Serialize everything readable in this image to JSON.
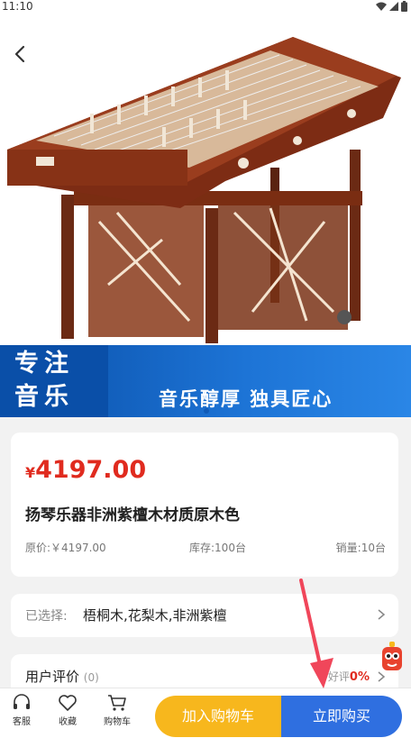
{
  "status_bar": {
    "time": "11:10"
  },
  "banner": {
    "line1": "专注",
    "line2": "音乐",
    "slogan": "音乐醇厚  独具匠心"
  },
  "product": {
    "currency": "¥",
    "price": "4197.00",
    "title": "扬琴乐器非洲紫檀木材质原木色",
    "original_price": "原价:￥4197.00",
    "stock": "库存:100台",
    "sales": "销量:10台"
  },
  "selection": {
    "label": "已选择:",
    "value": "梧桐木,花梨木,非洲紫檀"
  },
  "reviews": {
    "label": "用户评价",
    "count": "(0)",
    "good_label": "好评",
    "good_rate": "0%"
  },
  "bottom_bar": {
    "service": "客服",
    "favorite": "收藏",
    "cart": "购物车",
    "add_to_cart": "加入购物车",
    "buy_now": "立即购买"
  },
  "colors": {
    "price_red": "#e02b1f",
    "cart_yellow": "#f7b71d",
    "buy_blue": "#2f6fe0",
    "banner_blue": "#0a4fa8"
  }
}
